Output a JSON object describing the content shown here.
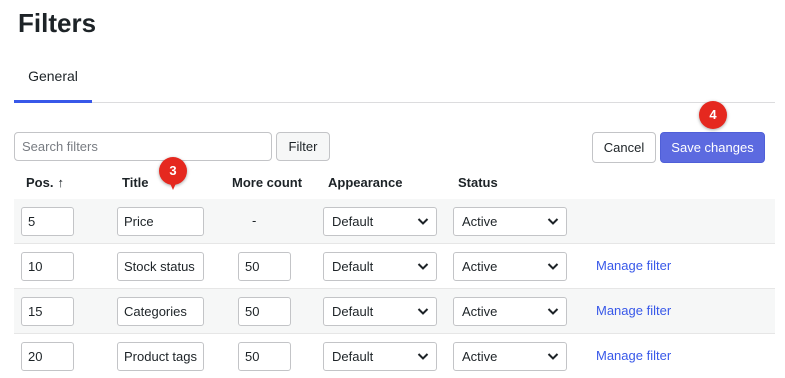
{
  "page": {
    "title": "Filters"
  },
  "tabs": [
    {
      "label": "General"
    }
  ],
  "toolbar": {
    "search_placeholder": "Search filters",
    "search_value": "",
    "filter_label": "Filter",
    "cancel_label": "Cancel",
    "save_label": "Save changes"
  },
  "annotations": {
    "badge_3": "3",
    "badge_4": "4"
  },
  "table": {
    "headers": {
      "pos": "Pos.",
      "pos_sort": "↑",
      "title": "Title",
      "more_count": "More count",
      "appearance": "Appearance",
      "status": "Status"
    },
    "rows": [
      {
        "pos": "5",
        "title": "Price",
        "more_count": "-",
        "appearance": "Default",
        "status": "Active",
        "action": ""
      },
      {
        "pos": "10",
        "title": "Stock status",
        "more_count": "50",
        "appearance": "Default",
        "status": "Active",
        "action": "Manage filter"
      },
      {
        "pos": "15",
        "title": "Categories",
        "more_count": "50",
        "appearance": "Default",
        "status": "Active",
        "action": "Manage filter"
      },
      {
        "pos": "20",
        "title": "Product tags",
        "more_count": "50",
        "appearance": "Default",
        "status": "Active",
        "action": "Manage filter"
      }
    ]
  },
  "colors": {
    "accent": "#3858e9",
    "primary_button": "#5c6ae0",
    "badge": "#e5281f",
    "row_shade": "#f6f7f7"
  },
  "icons": {
    "select_caret": "chevron-down-icon",
    "sort": "arrow-up-icon"
  }
}
